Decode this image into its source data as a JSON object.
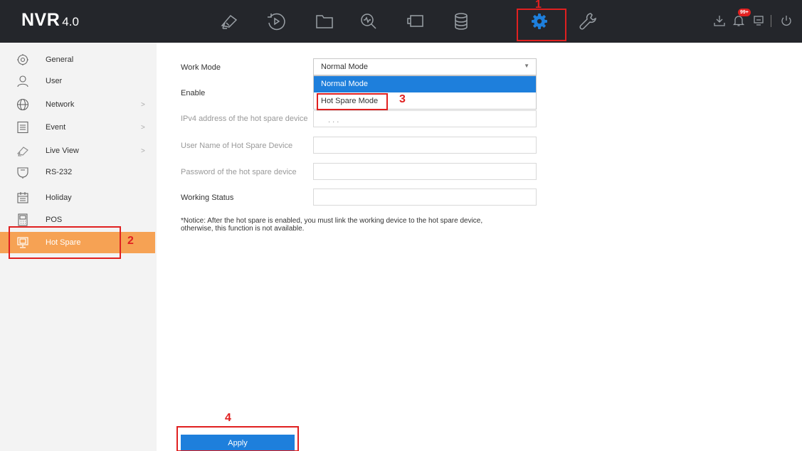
{
  "app": {
    "logo_main": "NVR",
    "logo_version": "4.0"
  },
  "topnav": {
    "items": [
      {
        "icon": "live-view-camera-icon",
        "active": false
      },
      {
        "icon": "playback-icon",
        "active": false
      },
      {
        "icon": "file-folder-icon",
        "active": false
      },
      {
        "icon": "smart-analysis-icon",
        "active": false
      },
      {
        "icon": "video-wall-icon",
        "active": false
      },
      {
        "icon": "storage-icon",
        "active": false
      },
      {
        "icon": "configuration-gear-icon",
        "active": true
      },
      {
        "icon": "maintenance-wrench-icon",
        "active": false
      }
    ],
    "right": {
      "notification_badge": "99+"
    }
  },
  "sidebar": {
    "items": [
      {
        "label": "General",
        "icon": "general-icon",
        "has_submenu": false
      },
      {
        "label": "User",
        "icon": "user-icon",
        "has_submenu": false
      },
      {
        "label": "Network",
        "icon": "network-globe-icon",
        "has_submenu": true
      },
      {
        "label": "Event",
        "icon": "event-icon",
        "has_submenu": true
      },
      {
        "label": "Live View",
        "icon": "live-view-icon",
        "has_submenu": true
      },
      {
        "label": "RS-232",
        "icon": "rs232-icon",
        "has_submenu": false
      },
      {
        "label": "Holiday",
        "icon": "holiday-calendar-icon",
        "has_submenu": false
      },
      {
        "label": "POS",
        "icon": "pos-icon",
        "has_submenu": false
      },
      {
        "label": "Hot Spare",
        "icon": "hot-spare-icon",
        "has_submenu": false,
        "active": true
      }
    ]
  },
  "form": {
    "work_mode": {
      "label": "Work Mode",
      "value": "Normal Mode",
      "options": [
        "Normal Mode",
        "Hot Spare Mode"
      ],
      "highlighted_option": "Normal Mode"
    },
    "enable_label": "Enable",
    "ipv4_label": "IPv4 address of the hot spare device",
    "ipv4_value": ". . .",
    "username_label": "User Name of Hot Spare Device",
    "password_label": "Password of the hot spare device",
    "working_status_label": "Working Status",
    "notice_line1": "*Notice: After the hot spare is enabled, you must link the working device to the hot spare device,",
    "notice_line2": "otherwise, this function is not available.",
    "apply_label": "Apply"
  },
  "annotations": [
    "1",
    "2",
    "3",
    "4"
  ],
  "colors": {
    "topbar_bg": "#24262b",
    "active_nav": "#1e7fdc",
    "sidebar_active": "#f6a254",
    "button_blue": "#1e7fdc",
    "annotation_red": "#e02020"
  }
}
